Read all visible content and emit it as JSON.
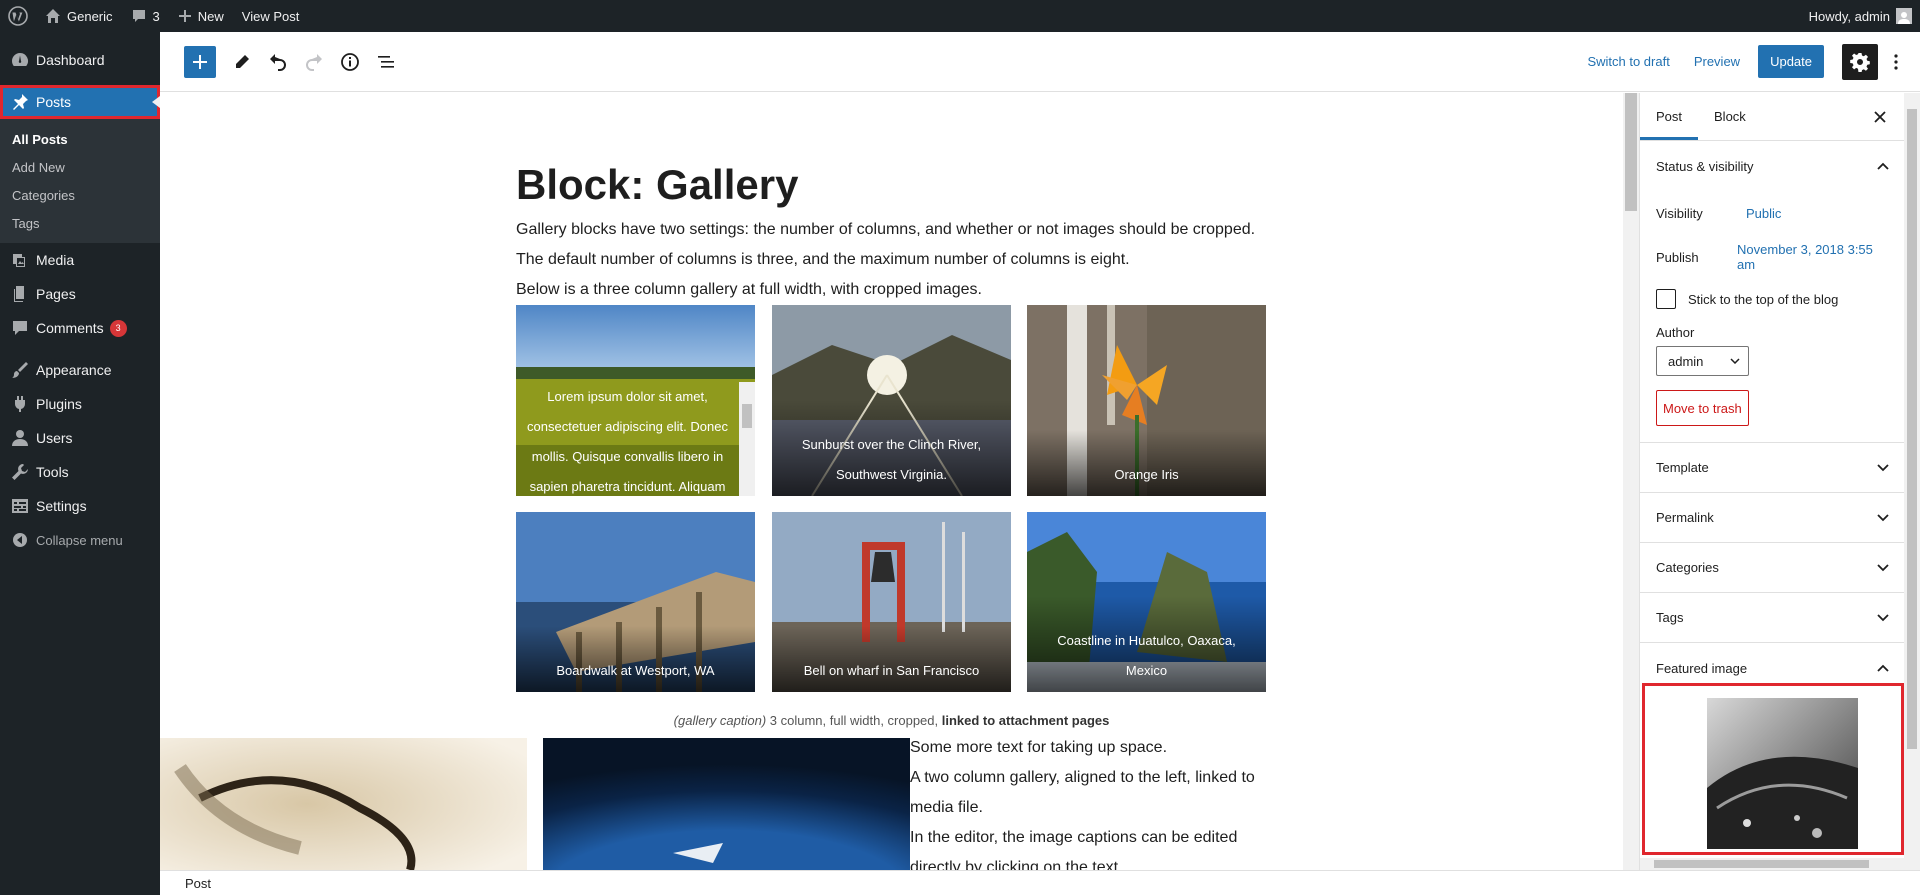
{
  "admin_bar": {
    "site_name": "Generic",
    "comments_count": "3",
    "new_label": "New",
    "view_post_label": "View Post",
    "howdy_label": "Howdy, admin"
  },
  "admin_menu": {
    "dashboard": "Dashboard",
    "posts": "Posts",
    "posts_submenu": [
      "All Posts",
      "Add New",
      "Categories",
      "Tags"
    ],
    "media": "Media",
    "pages": "Pages",
    "comments": "Comments",
    "comments_badge": "3",
    "appearance": "Appearance",
    "plugins": "Plugins",
    "users": "Users",
    "tools": "Tools",
    "settings": "Settings",
    "collapse": "Collapse menu"
  },
  "editor_header": {
    "switch_to_draft": "Switch to draft",
    "preview": "Preview",
    "update": "Update"
  },
  "post": {
    "title": "Block: Gallery",
    "paragraphs": [
      "Gallery blocks have two settings: the number of columns, and whether or not images should be cropped.",
      "The default number of columns is three, and the maximum number of columns is eight.",
      "Below is a three column gallery at full width, with cropped images."
    ],
    "gallery_captions": [
      "Lorem ipsum dolor sit amet, consectetuer adipiscing elit. Donec mollis. Quisque convallis libero in sapien pharetra tincidunt. Aliquam",
      "Sunburst over the Clinch River, Southwest Virginia.",
      "Orange Iris",
      "Boardwalk at Westport, WA",
      "Bell on wharf in San  Francisco",
      "Coastline in Huatulco, Oaxaca, Mexico"
    ],
    "gallery_caption_italic": "(gallery caption)",
    "gallery_caption_mid": " 3 column, full width, cropped, ",
    "gallery_caption_bold": "linked to attachment pages",
    "more_paragraphs": [
      "Some more text for taking up space.",
      "A two column gallery, aligned to the left, linked to",
      "media file.",
      "In the editor, the image captions can be edited",
      "directly by clicking on the text."
    ]
  },
  "footer": {
    "breadcrumb": "Post"
  },
  "settings_sidebar": {
    "tab_post": "Post",
    "tab_block": "Block",
    "status_visibility": "Status & visibility",
    "visibility_label": "Visibility",
    "visibility_value": "Public",
    "publish_label": "Publish",
    "publish_value": "November 3, 2018 3:55 am",
    "sticky_label": "Stick to the top of the blog",
    "author_label": "Author",
    "author_value": "admin",
    "trash_label": "Move to trash",
    "panels": [
      "Template",
      "Permalink",
      "Categories",
      "Tags"
    ],
    "featured_image": "Featured image"
  },
  "colors": {
    "admin_bg": "#1d2327",
    "accent": "#2271b1",
    "highlight": "#e0272e",
    "danger": "#cc1818"
  }
}
